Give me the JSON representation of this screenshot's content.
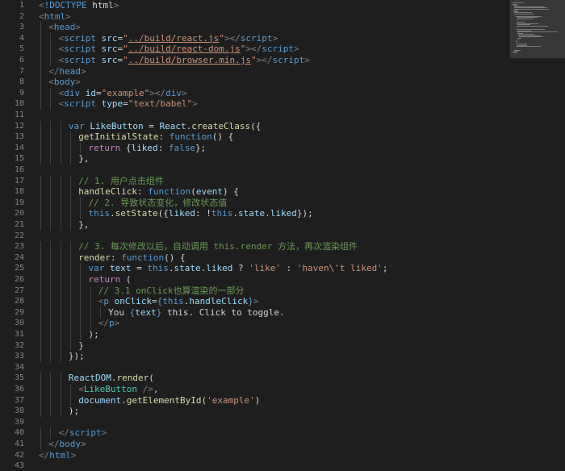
{
  "editor": {
    "language": "html",
    "colors": {
      "background": "#1e1e1e",
      "line_number": "#858585",
      "tag": "#569cd6",
      "attribute": "#9cdcfe",
      "string": "#ce9178",
      "keyword": "#c586c0",
      "function": "#dcdcaa",
      "comment": "#6a9955"
    },
    "lines": [
      {
        "num": "1",
        "indent": 0,
        "tokens": [
          [
            "punct",
            "<"
          ],
          [
            "tag",
            "!DOCTYPE"
          ],
          [
            "text",
            " html"
          ],
          [
            "punct",
            ">"
          ]
        ]
      },
      {
        "num": "2",
        "indent": 0,
        "tokens": [
          [
            "punct",
            "<"
          ],
          [
            "tag",
            "html"
          ],
          [
            "punct",
            ">"
          ]
        ]
      },
      {
        "num": "3",
        "indent": 1,
        "tokens": [
          [
            "punct",
            "<"
          ],
          [
            "tag",
            "head"
          ],
          [
            "punct",
            ">"
          ]
        ]
      },
      {
        "num": "4",
        "indent": 2,
        "tokens": [
          [
            "punct",
            "<"
          ],
          [
            "tag",
            "script"
          ],
          [
            "text",
            " "
          ],
          [
            "attr",
            "src"
          ],
          [
            "text",
            "="
          ],
          [
            "str",
            "\""
          ],
          [
            "link",
            "../build/react.js"
          ],
          [
            "str",
            "\""
          ],
          [
            "punct",
            "></"
          ],
          [
            "tag",
            "script"
          ],
          [
            "punct",
            ">"
          ]
        ]
      },
      {
        "num": "5",
        "indent": 2,
        "tokens": [
          [
            "punct",
            "<"
          ],
          [
            "tag",
            "script"
          ],
          [
            "text",
            " "
          ],
          [
            "attr",
            "src"
          ],
          [
            "text",
            "="
          ],
          [
            "str",
            "\""
          ],
          [
            "link",
            "../build/react-dom.js"
          ],
          [
            "str",
            "\""
          ],
          [
            "punct",
            "></"
          ],
          [
            "tag",
            "script"
          ],
          [
            "punct",
            ">"
          ]
        ]
      },
      {
        "num": "6",
        "indent": 2,
        "tokens": [
          [
            "punct",
            "<"
          ],
          [
            "tag",
            "script"
          ],
          [
            "text",
            " "
          ],
          [
            "attr",
            "src"
          ],
          [
            "text",
            "="
          ],
          [
            "str",
            "\""
          ],
          [
            "link",
            "../build/browser.min.js"
          ],
          [
            "str",
            "\""
          ],
          [
            "punct",
            "></"
          ],
          [
            "tag",
            "script"
          ],
          [
            "punct",
            ">"
          ]
        ]
      },
      {
        "num": "7",
        "indent": 1,
        "tokens": [
          [
            "punct",
            "</"
          ],
          [
            "tag",
            "head"
          ],
          [
            "punct",
            ">"
          ]
        ]
      },
      {
        "num": "8",
        "indent": 1,
        "tokens": [
          [
            "punct",
            "<"
          ],
          [
            "tag",
            "body"
          ],
          [
            "punct",
            ">"
          ]
        ]
      },
      {
        "num": "9",
        "indent": 2,
        "tokens": [
          [
            "punct",
            "<"
          ],
          [
            "tag",
            "div"
          ],
          [
            "text",
            " "
          ],
          [
            "attr",
            "id"
          ],
          [
            "text",
            "="
          ],
          [
            "str",
            "\"example\""
          ],
          [
            "punct",
            "></"
          ],
          [
            "tag",
            "div"
          ],
          [
            "punct",
            ">"
          ]
        ]
      },
      {
        "num": "10",
        "indent": 2,
        "tokens": [
          [
            "punct",
            "<"
          ],
          [
            "tag",
            "script"
          ],
          [
            "text",
            " "
          ],
          [
            "attr",
            "type"
          ],
          [
            "text",
            "="
          ],
          [
            "str",
            "\"text/babel\""
          ],
          [
            "punct",
            ">"
          ]
        ]
      },
      {
        "num": "11",
        "indent": 0,
        "tokens": []
      },
      {
        "num": "12",
        "indent": 3,
        "tokens": [
          [
            "kw2",
            "var"
          ],
          [
            "text",
            " "
          ],
          [
            "var",
            "LikeButton"
          ],
          [
            "text",
            " = "
          ],
          [
            "var",
            "React"
          ],
          [
            "text",
            "."
          ],
          [
            "fn",
            "createClass"
          ],
          [
            "text",
            "({"
          ]
        ]
      },
      {
        "num": "13",
        "indent": 4,
        "tokens": [
          [
            "fn",
            "getInitialState"
          ],
          [
            "text",
            ": "
          ],
          [
            "kw2",
            "function"
          ],
          [
            "text",
            "() {"
          ]
        ]
      },
      {
        "num": "14",
        "indent": 5,
        "tokens": [
          [
            "kw",
            "return"
          ],
          [
            "text",
            " {"
          ],
          [
            "var",
            "liked"
          ],
          [
            "text",
            ": "
          ],
          [
            "kw2",
            "false"
          ],
          [
            "text",
            "};"
          ]
        ]
      },
      {
        "num": "15",
        "indent": 4,
        "tokens": [
          [
            "text",
            "},"
          ]
        ]
      },
      {
        "num": "16",
        "indent": 0,
        "tokens": []
      },
      {
        "num": "17",
        "indent": 4,
        "tokens": [
          [
            "comment",
            "// 1. 用户点击组件"
          ]
        ]
      },
      {
        "num": "18",
        "indent": 4,
        "tokens": [
          [
            "fn",
            "handleClick"
          ],
          [
            "text",
            ": "
          ],
          [
            "kw2",
            "function"
          ],
          [
            "text",
            "("
          ],
          [
            "var",
            "event"
          ],
          [
            "text",
            ") {"
          ]
        ]
      },
      {
        "num": "19",
        "indent": 5,
        "tokens": [
          [
            "comment",
            "// 2. 导致状态变化，修改状态值"
          ]
        ]
      },
      {
        "num": "20",
        "indent": 5,
        "tokens": [
          [
            "kw2",
            "this"
          ],
          [
            "text",
            "."
          ],
          [
            "fn",
            "setState"
          ],
          [
            "text",
            "({"
          ],
          [
            "var",
            "liked"
          ],
          [
            "text",
            ": !"
          ],
          [
            "kw2",
            "this"
          ],
          [
            "text",
            "."
          ],
          [
            "var",
            "state"
          ],
          [
            "text",
            "."
          ],
          [
            "var",
            "liked"
          ],
          [
            "text",
            "});"
          ]
        ]
      },
      {
        "num": "21",
        "indent": 4,
        "tokens": [
          [
            "text",
            "},"
          ]
        ]
      },
      {
        "num": "22",
        "indent": 0,
        "tokens": []
      },
      {
        "num": "23",
        "indent": 4,
        "tokens": [
          [
            "comment",
            "// 3. 每次修改以后，自动调用 this.render 方法，再次渲染组件"
          ]
        ]
      },
      {
        "num": "24",
        "indent": 4,
        "tokens": [
          [
            "fn",
            "render"
          ],
          [
            "text",
            ": "
          ],
          [
            "kw2",
            "function"
          ],
          [
            "text",
            "() {"
          ]
        ]
      },
      {
        "num": "25",
        "indent": 5,
        "tokens": [
          [
            "kw2",
            "var"
          ],
          [
            "text",
            " "
          ],
          [
            "var",
            "text"
          ],
          [
            "text",
            " = "
          ],
          [
            "kw2",
            "this"
          ],
          [
            "text",
            "."
          ],
          [
            "var",
            "state"
          ],
          [
            "text",
            "."
          ],
          [
            "var",
            "liked"
          ],
          [
            "text",
            " ? "
          ],
          [
            "str",
            "'like'"
          ],
          [
            "text",
            " : "
          ],
          [
            "str",
            "'haven\\'t liked'"
          ],
          [
            "text",
            ";"
          ]
        ]
      },
      {
        "num": "26",
        "indent": 5,
        "tokens": [
          [
            "kw",
            "return"
          ],
          [
            "text",
            " ("
          ]
        ]
      },
      {
        "num": "27",
        "indent": 6,
        "tokens": [
          [
            "comment",
            "// 3.1 onClick也算渲染的一部分"
          ]
        ]
      },
      {
        "num": "28",
        "indent": 6,
        "tokens": [
          [
            "punct",
            "<"
          ],
          [
            "tag",
            "p"
          ],
          [
            "text",
            " "
          ],
          [
            "attr",
            "onClick"
          ],
          [
            "text",
            "="
          ],
          [
            "kw2",
            "{"
          ],
          [
            "kw2",
            "this"
          ],
          [
            "text",
            "."
          ],
          [
            "var",
            "handleClick"
          ],
          [
            "kw2",
            "}"
          ],
          [
            "punct",
            ">"
          ]
        ]
      },
      {
        "num": "29",
        "indent": 7,
        "tokens": [
          [
            "text",
            "You "
          ],
          [
            "kw2",
            "{"
          ],
          [
            "var",
            "text"
          ],
          [
            "kw2",
            "}"
          ],
          [
            "text",
            " this. Click to toggle."
          ]
        ]
      },
      {
        "num": "30",
        "indent": 6,
        "tokens": [
          [
            "punct",
            "</"
          ],
          [
            "tag",
            "p"
          ],
          [
            "punct",
            ">"
          ]
        ]
      },
      {
        "num": "31",
        "indent": 5,
        "tokens": [
          [
            "text",
            ");"
          ]
        ]
      },
      {
        "num": "32",
        "indent": 4,
        "tokens": [
          [
            "text",
            "}"
          ]
        ]
      },
      {
        "num": "33",
        "indent": 3,
        "tokens": [
          [
            "text",
            "});"
          ]
        ]
      },
      {
        "num": "34",
        "indent": 0,
        "tokens": []
      },
      {
        "num": "35",
        "indent": 3,
        "tokens": [
          [
            "var",
            "ReactDOM"
          ],
          [
            "text",
            "."
          ],
          [
            "fn",
            "render"
          ],
          [
            "text",
            "("
          ]
        ]
      },
      {
        "num": "36",
        "indent": 4,
        "tokens": [
          [
            "punct",
            "<"
          ],
          [
            "jsx",
            "LikeButton"
          ],
          [
            "text",
            " "
          ],
          [
            "punct",
            "/>"
          ],
          [
            "text",
            ","
          ]
        ]
      },
      {
        "num": "37",
        "indent": 4,
        "tokens": [
          [
            "var",
            "document"
          ],
          [
            "text",
            "."
          ],
          [
            "fn",
            "getElementById"
          ],
          [
            "text",
            "("
          ],
          [
            "str",
            "'example'"
          ],
          [
            "text",
            ")"
          ]
        ]
      },
      {
        "num": "38",
        "indent": 3,
        "tokens": [
          [
            "text",
            ");"
          ]
        ]
      },
      {
        "num": "39",
        "indent": 0,
        "tokens": []
      },
      {
        "num": "40",
        "indent": 2,
        "tokens": [
          [
            "punct",
            "</"
          ],
          [
            "tag",
            "script"
          ],
          [
            "punct",
            ">"
          ]
        ]
      },
      {
        "num": "41",
        "indent": 1,
        "tokens": [
          [
            "punct",
            "</"
          ],
          [
            "tag",
            "body"
          ],
          [
            "punct",
            ">"
          ]
        ]
      },
      {
        "num": "42",
        "indent": 0,
        "tokens": [
          [
            "punct",
            "</"
          ],
          [
            "tag",
            "html"
          ],
          [
            "punct",
            ">"
          ]
        ]
      },
      {
        "num": "43",
        "indent": 0,
        "tokens": []
      }
    ]
  }
}
